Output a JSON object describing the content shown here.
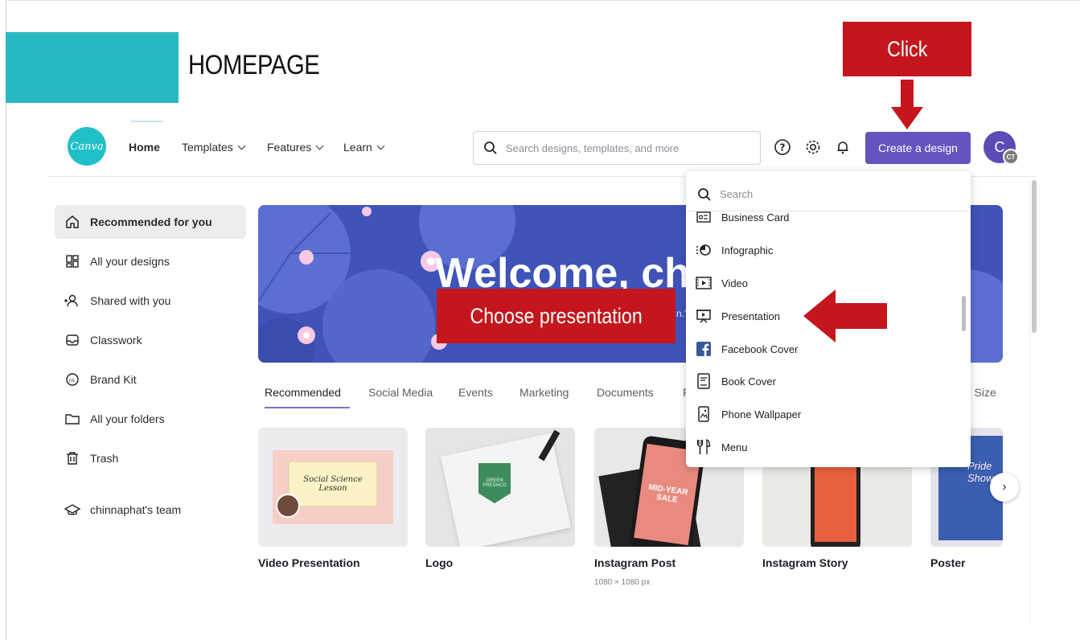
{
  "slide": {
    "heading": "HOMEPAGE",
    "callout_click": "Click",
    "callout_choose": "Choose presentation"
  },
  "topbar": {
    "logo_text": "Canva",
    "nav": [
      {
        "label": "Home"
      },
      {
        "label": "Templates"
      },
      {
        "label": "Features"
      },
      {
        "label": "Learn"
      }
    ],
    "search_placeholder": "Search designs, templates, and more",
    "create_button": "Create a design",
    "avatar_initial": "C",
    "avatar_badge": "CT"
  },
  "sidebar": {
    "items": [
      {
        "label": "Recommended for you"
      },
      {
        "label": "All your designs"
      },
      {
        "label": "Shared with you"
      },
      {
        "label": "Classwork"
      },
      {
        "label": "Brand Kit"
      },
      {
        "label": "All your folders"
      },
      {
        "label": "Trash"
      }
    ],
    "team": "chinnaphat's team"
  },
  "banner": {
    "title": "Welcome, chin",
    "subtitle": "n.\""
  },
  "tabs": [
    {
      "label": "Recommended"
    },
    {
      "label": "Social Media"
    },
    {
      "label": "Events"
    },
    {
      "label": "Marketing"
    },
    {
      "label": "Documents"
    },
    {
      "label": "F"
    },
    {
      "label": "m Size"
    }
  ],
  "cards": [
    {
      "label": "Video Presentation",
      "thumb_text": "Social Science Lesson"
    },
    {
      "label": "Logo",
      "thumb_text": "GREEN FRESHCO"
    },
    {
      "label": "Instagram Post",
      "sub": "1080 × 1080 px",
      "thumb_text": "MID-YEAR SALE"
    },
    {
      "label": "Instagram Story"
    },
    {
      "label": "Poster",
      "thumb_text": "Pride Show"
    }
  ],
  "dropdown": {
    "search_placeholder": "Search",
    "items": [
      {
        "label": "Business Card",
        "icon": "business-card-icon"
      },
      {
        "label": "Infographic",
        "icon": "infographic-icon"
      },
      {
        "label": "Video",
        "icon": "video-icon"
      },
      {
        "label": "Presentation",
        "icon": "presentation-icon"
      },
      {
        "label": "Facebook Cover",
        "icon": "facebook-icon"
      },
      {
        "label": "Book Cover",
        "icon": "book-icon"
      },
      {
        "label": "Phone Wallpaper",
        "icon": "phone-icon"
      },
      {
        "label": "Menu",
        "icon": "menu-icon"
      }
    ]
  },
  "colors": {
    "teal": "#27b9c1",
    "callout_red": "#c4161c",
    "create_purple": "#6554c0",
    "banner_blue": "#3f53b8"
  }
}
